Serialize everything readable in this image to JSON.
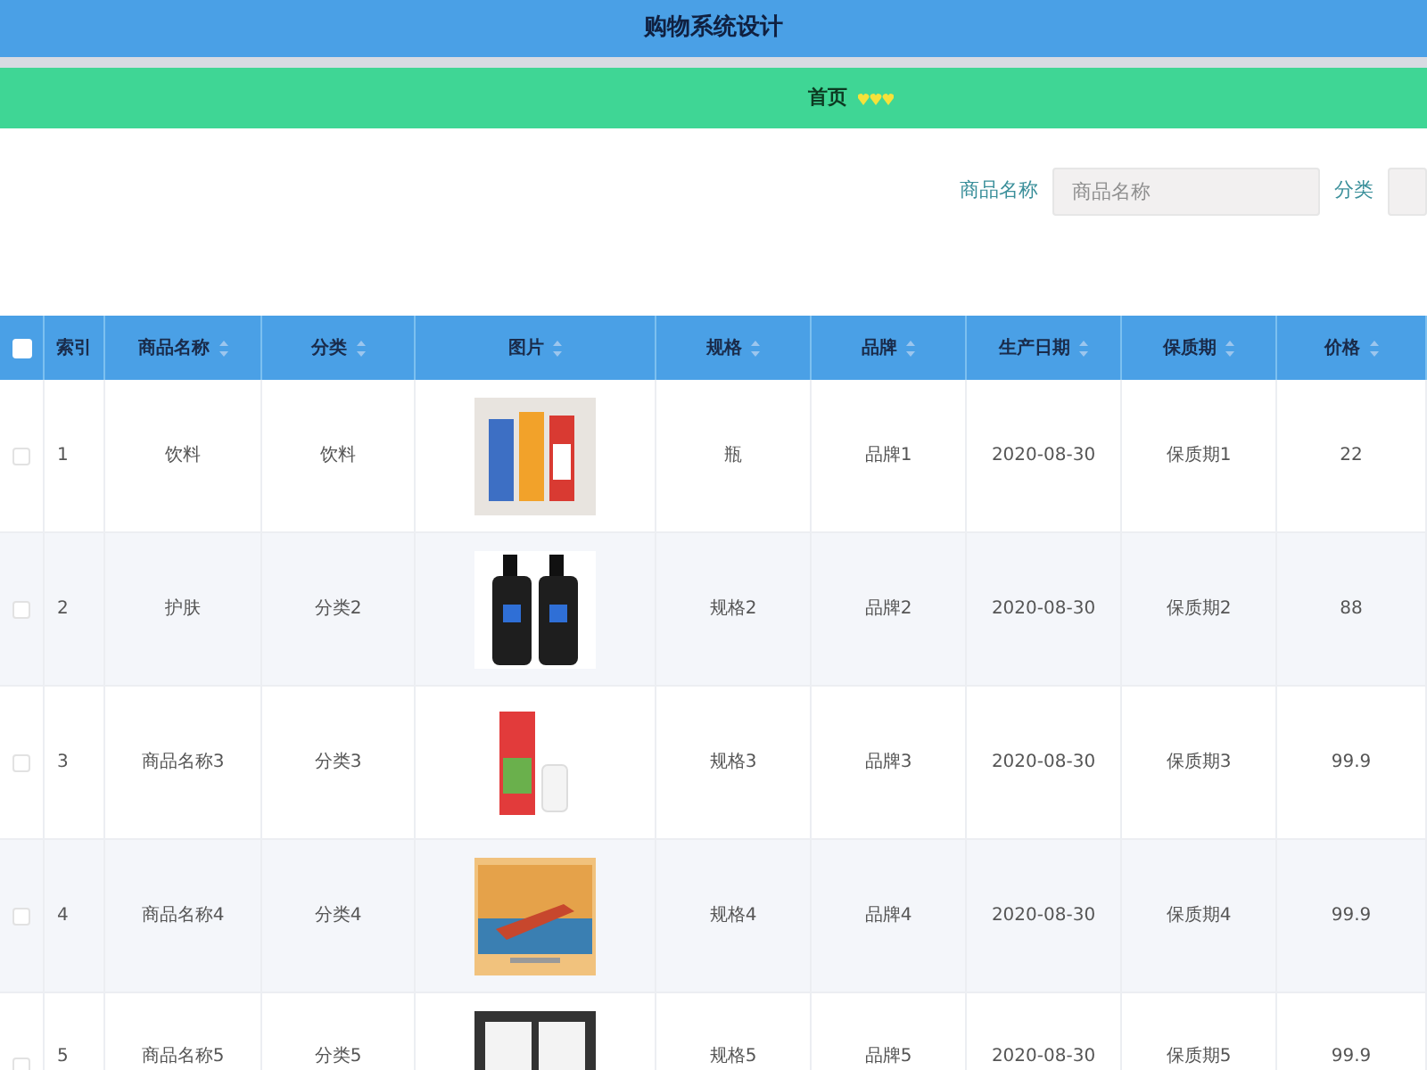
{
  "header": {
    "title": "购物系统设计"
  },
  "breadcrumb": {
    "home": "首页"
  },
  "search": {
    "fields": [
      {
        "label": "商品名称",
        "placeholder": "商品名称"
      },
      {
        "label": "分类"
      }
    ]
  },
  "table": {
    "select_all": {
      "checked": false
    },
    "columns": [
      "索引",
      "商品名称",
      "分类",
      "图片",
      "规格",
      "品牌",
      "生产日期",
      "保质期",
      "价格"
    ],
    "rows": [
      {
        "checked": false,
        "cells": [
          "1",
          "饮料",
          "饮料",
          {
            "kind": "picture"
          },
          "瓶",
          "品牌1",
          "2020-08-30",
          "保质期1",
          "22"
        ]
      },
      {
        "checked": false,
        "cells": [
          "2",
          "护肤",
          "分类2",
          {
            "kind": "picture"
          },
          "规格2",
          "品牌2",
          "2020-08-30",
          "保质期2",
          "88"
        ]
      },
      {
        "checked": false,
        "cells": [
          "3",
          "商品名称3",
          "分类3",
          {
            "kind": "picture"
          },
          "规格3",
          "品牌3",
          "2020-08-30",
          "保质期3",
          "99.9"
        ]
      },
      {
        "checked": false,
        "cells": [
          "4",
          "商品名称4",
          "分类4",
          {
            "kind": "picture"
          },
          "规格4",
          "品牌4",
          "2020-08-30",
          "保质期4",
          "99.9"
        ]
      },
      {
        "checked": false,
        "cells": [
          "5",
          "商品名称5",
          "分类5",
          {
            "kind": "picture"
          },
          "规格5",
          "品牌5",
          "2020-08-30",
          "保质期5",
          "99.9"
        ]
      }
    ]
  }
}
